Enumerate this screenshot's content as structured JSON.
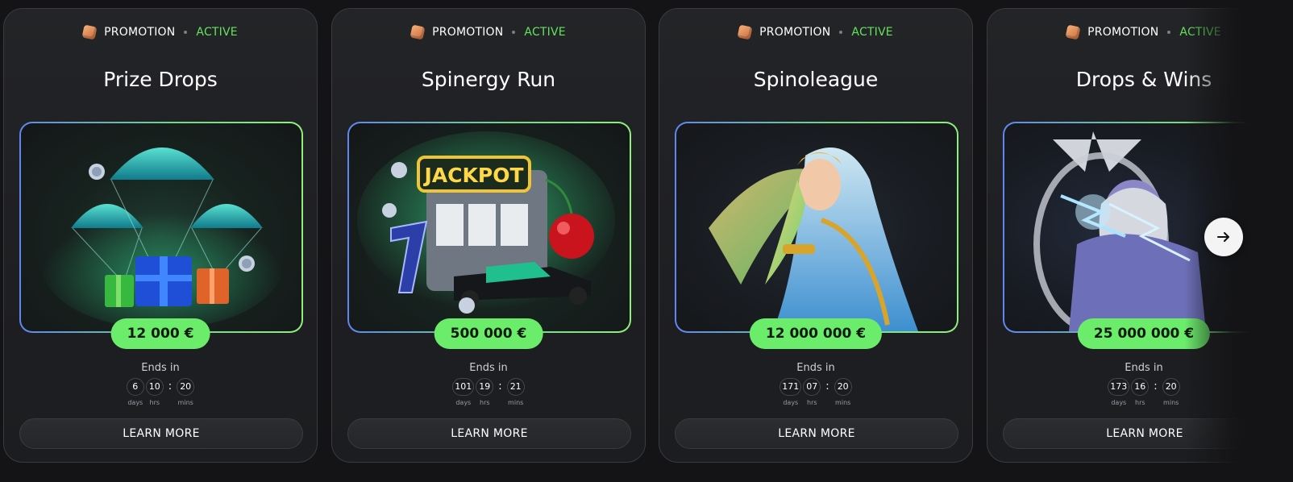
{
  "cards": [
    {
      "tag": "PROMOTION",
      "status": "ACTIVE",
      "title": "Prize Drops",
      "prize": "12 000 €",
      "ends_label": "Ends in",
      "timer": {
        "days": "6",
        "hrs": "10",
        "mins": "20"
      },
      "units": {
        "days": "days",
        "hrs": "hrs",
        "mins": "mins"
      },
      "button": "LEARN MORE",
      "art": "parachute-gift-boxes"
    },
    {
      "tag": "PROMOTION",
      "status": "ACTIVE",
      "title": "Spinergy Run",
      "prize": "500 000 €",
      "ends_label": "Ends in",
      "timer": {
        "days": "101",
        "hrs": "19",
        "mins": "21"
      },
      "units": {
        "days": "days",
        "hrs": "hrs",
        "mins": "mins"
      },
      "button": "LEARN MORE",
      "art": "jackpot-slot-race-car",
      "art_text": "JACKPOT"
    },
    {
      "tag": "PROMOTION",
      "status": "ACTIVE",
      "title": "Spinoleague",
      "prize": "12 000 000 €",
      "ends_label": "Ends in",
      "timer": {
        "days": "171",
        "hrs": "07",
        "mins": "20"
      },
      "units": {
        "days": "days",
        "hrs": "hrs",
        "mins": "mins"
      },
      "button": "LEARN MORE",
      "art": "golden-goddess"
    },
    {
      "tag": "PROMOTION",
      "status": "ACTIVE",
      "title": "Drops & Wins",
      "prize": "25 000 000 €",
      "ends_label": "Ends in",
      "timer": {
        "days": "173",
        "hrs": "16",
        "mins": "20"
      },
      "units": {
        "days": "days",
        "hrs": "hrs",
        "mins": "mins"
      },
      "button": "LEARN MORE",
      "art": "lightning-god"
    }
  ],
  "carousel": {
    "next_icon": "arrow-right-icon"
  },
  "colors": {
    "accent_green": "#6bec6a",
    "active_text": "#63e35e",
    "background": "#141416"
  }
}
